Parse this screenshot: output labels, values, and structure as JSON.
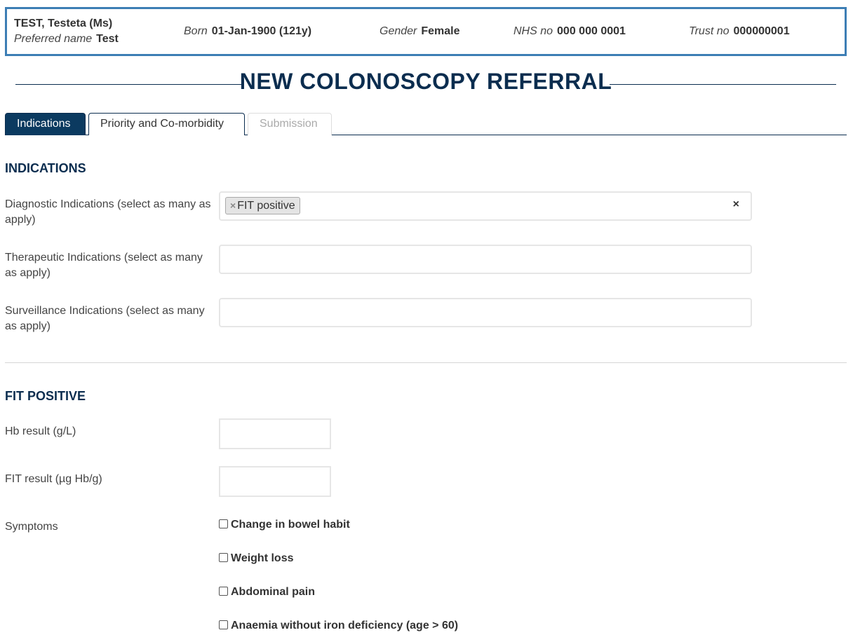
{
  "patient": {
    "name": "TEST, Testeta (Ms)",
    "preferred_label": "Preferred name",
    "preferred_value": "Test",
    "born_label": "Born",
    "born_value": "01-Jan-1900 (121y)",
    "gender_label": "Gender",
    "gender_value": "Female",
    "nhs_label": "NHS no",
    "nhs_value": "000 000 0001",
    "trust_label": "Trust no",
    "trust_value": "000000001"
  },
  "page": {
    "title": "NEW COLONOSCOPY REFERRAL"
  },
  "tabs": [
    {
      "label": "Indications",
      "state": "active"
    },
    {
      "label": "Priority and Co-morbidity",
      "state": "normal"
    },
    {
      "label": "Submission",
      "state": "disabled"
    }
  ],
  "indications": {
    "heading": "INDICATIONS",
    "diagnostic_label": "Diagnostic Indications (select as many as apply)",
    "diagnostic_selected": "FIT positive",
    "tag_remove": "×",
    "clear": "×",
    "therapeutic_label": "Therapeutic Indications (select as many as apply)",
    "surveillance_label": "Surveillance Indications (select as many as apply)"
  },
  "fit_positive": {
    "heading": "FIT POSITIVE",
    "hb_label": "Hb result (g/L)",
    "hb_value": "",
    "fit_label": "FIT result (µg Hb/g)",
    "fit_value": "",
    "symptoms_label": "Symptoms",
    "symptoms": [
      "Change in bowel habit",
      "Weight loss",
      "Abdominal pain",
      "Anaemia without iron deficiency (age > 60)"
    ]
  },
  "colors": {
    "primary": "#0b2d4f",
    "tab_active_bg": "#0b3a60",
    "banner_border": "#3d7eb5"
  }
}
